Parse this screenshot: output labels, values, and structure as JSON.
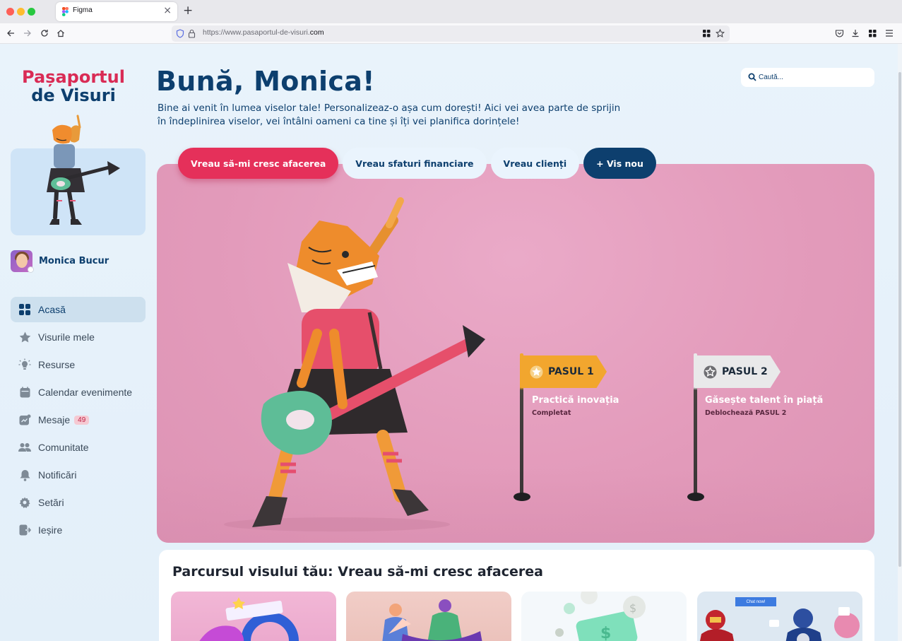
{
  "browser": {
    "tab_title": "Figma",
    "tab_close": "×",
    "new_tab": "+",
    "url_prefix": "https://www.pasaportul-de-visuri.",
    "url_suffix": "com"
  },
  "sidebar": {
    "logo_line1": "Pașaportul",
    "logo_line2": "de Visuri",
    "profile_name": "Monica Bucur",
    "items": [
      {
        "label": "Acasă",
        "icon": "grid-icon",
        "active": true
      },
      {
        "label": "Visurile mele",
        "icon": "star-icon"
      },
      {
        "label": "Resurse",
        "icon": "lightbulb-icon"
      },
      {
        "label": "Calendar evenimente",
        "icon": "calendar-icon"
      },
      {
        "label": "Mesaje",
        "icon": "message-icon",
        "badge": "49"
      },
      {
        "label": "Comunitate",
        "icon": "community-icon"
      },
      {
        "label": "Notificări",
        "icon": "bell-icon"
      },
      {
        "label": "Setări",
        "icon": "gear-icon"
      },
      {
        "label": "Ieșire",
        "icon": "exit-icon"
      }
    ]
  },
  "header": {
    "greeting": "Bună, Monica!",
    "intro": "Bine ai venit în lumea viselor tale! Personalizeaz-o așa cum dorești! Aici vei avea parte de sprijin în îndeplinirea viselor, vei întâlni oameni ca tine și îți vei planifica dorințele!",
    "search_placeholder": "Caută..."
  },
  "goal_tabs": [
    {
      "label": "Vreau să-mi cresc afacerea",
      "style": "active"
    },
    {
      "label": "Vreau sfaturi financiare",
      "style": "light"
    },
    {
      "label": "Vreau clienți",
      "style": "light"
    },
    {
      "label": "+ Vis nou",
      "style": "dark"
    }
  ],
  "steps": [
    {
      "badge": "PASUL 1",
      "title": "Practică inovația",
      "status": "Completat",
      "color": "#f2a62e"
    },
    {
      "badge": "PASUL 2",
      "title": "Găsește talent în piață",
      "status": "Deblochează PASUL 2",
      "color": "#e9e9ea"
    }
  ],
  "journey": {
    "title": "Parcursul visului tău:  Vreau să-mi cresc afacerea",
    "card4_chat": "Chat now!"
  },
  "colors": {
    "brand_blue": "#0d3f6e",
    "brand_red": "#d92b55",
    "hero_pink": "#e39bbb",
    "step_gold": "#f2a62e"
  }
}
